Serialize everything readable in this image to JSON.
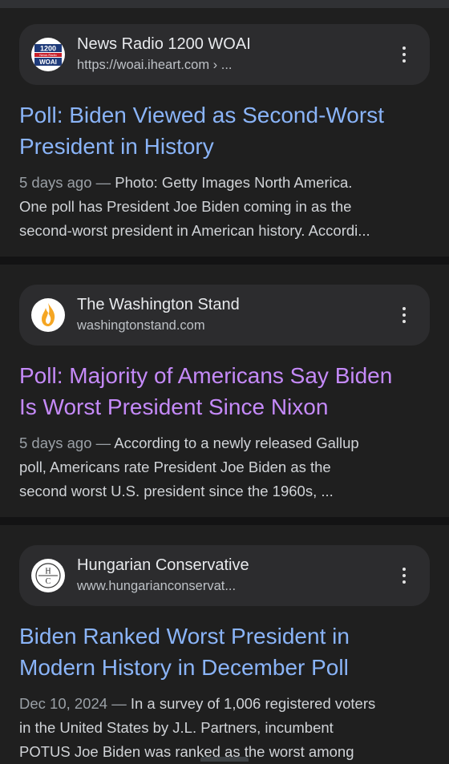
{
  "results": [
    {
      "site_name": "News Radio 1200 WOAI",
      "site_url": "https://woai.iheart.com › ...",
      "favicon_icon": "woai-logo-icon",
      "favicon_text_top": "1200",
      "favicon_text_mid": "News Radio",
      "favicon_text_bottom": "WOAI",
      "title_line1": "Poll: Biden Viewed as Second-Worst",
      "title_line2": "President in History",
      "visited": false,
      "date": "5 days ago",
      "snippet_line1": "Photo: Getty Images North America.",
      "snippet_line2": "One poll has President Joe Biden coming in as the",
      "snippet_line3": "second-worst president in American history. Accordi..."
    },
    {
      "site_name": "The Washington Stand",
      "site_url": "washingtonstand.com",
      "favicon_icon": "flame-icon",
      "title_line1": "Poll: Majority of Americans Say Biden",
      "title_line2": "Is Worst President Since Nixon",
      "visited": true,
      "date": "5 days ago",
      "snippet_line1": "According to a newly released Gallup",
      "snippet_line2": "poll, Americans rate President Joe Biden as the",
      "snippet_line3": "second worst U.S. president since the 1960s, ..."
    },
    {
      "site_name": "Hungarian Conservative",
      "site_url": "www.hungarianconservat...",
      "favicon_icon": "hc-monogram-icon",
      "favicon_text_top": "H",
      "favicon_text_bottom": "C",
      "title_line1": "Biden Ranked Worst President in",
      "title_line2": "Modern History in December Poll",
      "visited": false,
      "date": "Dec 10, 2024",
      "snippet_line1": "In a survey of 1,006 registered voters",
      "snippet_line2": "in the United States by J.L. Partners, incumbent",
      "snippet_line3": "POTUS Joe Biden was ranked as the worst among"
    }
  ],
  "dash": "—",
  "colors": {
    "background": "#1f1f1f",
    "link": "#8ab4f8",
    "visited_link": "#c58af9",
    "pill": "#2c2c2e"
  }
}
